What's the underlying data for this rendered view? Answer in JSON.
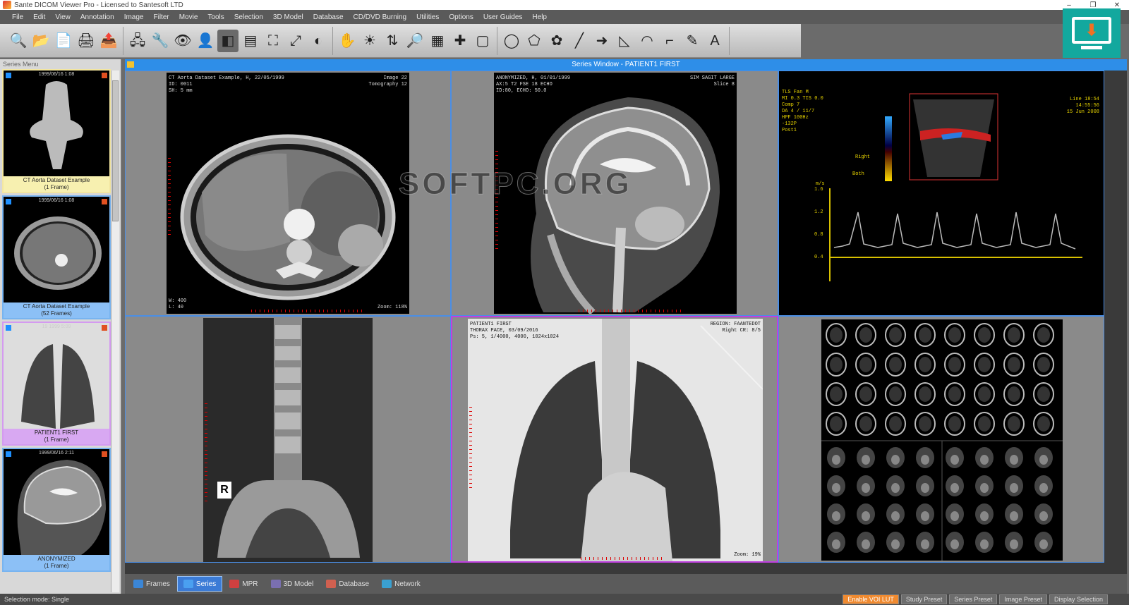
{
  "window": {
    "title": "Sante DICOM Viewer Pro - Licensed to Santesoft LTD",
    "controls": [
      "–",
      "❐",
      "✕"
    ]
  },
  "menu": [
    "File",
    "Edit",
    "View",
    "Annotation",
    "Image",
    "Filter",
    "Movie",
    "Tools",
    "Selection",
    "3D Model",
    "Database",
    "CD/DVD Burning",
    "Utilities",
    "Options",
    "User Guides",
    "Help"
  ],
  "toolbar": {
    "groups": [
      [
        "zoom-icon",
        "open-icon",
        "document-icon",
        "print-icon",
        "export-icon"
      ],
      [
        "network-icon",
        "tools-icon",
        "eye-icon",
        "user-icon",
        "window-level-icon",
        "lut-icon",
        "fit-icon",
        "fullscreen-icon",
        "invert-icon"
      ],
      [
        "hand-icon",
        "brightness-icon",
        "rotate-icon",
        "magnifier-icon",
        "tile-icon",
        "probe-icon",
        "rectangle-icon"
      ],
      [
        "ellipse-roi-icon",
        "polygon-roi-icon",
        "color-icon",
        "line-icon",
        "arrow-icon",
        "angle-icon",
        "cobb-icon",
        "ruler-icon",
        "pencil-icon",
        "text-icon"
      ]
    ],
    "glyphs": [
      "🔍",
      "📂",
      "📄",
      "🖨",
      "📤",
      "🖧",
      "🔧",
      "👁",
      "👤",
      "◧",
      "▤",
      "⛶",
      "⤢",
      "◐",
      "✋",
      "☀",
      "⇅",
      "🔎",
      "▦",
      "✚",
      "▢",
      "◯",
      "⬠",
      "✿",
      "╱",
      "➜",
      "◺",
      "◠",
      "⌐",
      "✎",
      "A"
    ]
  },
  "left_panel": {
    "title": "Series Menu",
    "series": [
      {
        "header": "1999/06/16 1:08",
        "label": "CT Aorta Dataset Example",
        "count": "(1 Frame)",
        "style": "yellow"
      },
      {
        "header": "1999/06/16 1:08",
        "label": "CT Aorta Dataset Example",
        "count": "(52 Frames)",
        "style": "blue"
      },
      {
        "header": "19 1999 5:09",
        "label": "PATIENT1 FIRST",
        "count": "(1 Frame)",
        "style": "purple"
      },
      {
        "header": "1999/06/16 2:11",
        "label": "ANONYMIZED",
        "count": "(1 Frame)",
        "style": "blue"
      }
    ]
  },
  "series_window": {
    "title": "Series Window - PATIENT1 FIRST"
  },
  "viewports": {
    "ct": {
      "tl": "CT Aorta Dataset Example, H, 22/05/1999\nID: 0011\nSH: 5 mm",
      "tr": "Image 22\nTomography 12",
      "bl": "W: 400\nL: 40",
      "br": "Zoom: 118%"
    },
    "mri": {
      "tl": "ANONYMIZED, H, 01/01/1999\nAX:5 T2 FSE 18 ECHO\nID:80, ECHO: 50.0",
      "tr": "SIM SAGIT LARGE\nSlice 8"
    },
    "us": {
      "tl": "TLS Fan M\nMI 0.3 TIS 0.0\nComp 7\nDA 4 / 11/7\nHPF 100Hz\n-132P\nPost1",
      "tr": "Line 18:54\n14:55:56\n15 Jun 2008",
      "label_a": "Right",
      "label_b": "Both",
      "axis_ticks": [
        "1.6",
        "1.2",
        "0.8",
        "0.4"
      ],
      "axis_unit": "m/s"
    },
    "xray": {
      "tl": "PATIENT1 FIRST\nTHORAX PACE, 03/09/2016\nPs: 5, 1/4000, 4000, 1024x1024",
      "tr": "REGION: FAANTEDOT\nRight CR: 8/5",
      "br": "Zoom: 19%"
    },
    "abd": {
      "marker": "R"
    }
  },
  "bottom_tabs": [
    {
      "label": "Frames",
      "icon_color": "#3b86d6",
      "active": false
    },
    {
      "label": "Series",
      "icon_color": "#4aa0f0",
      "active": true
    },
    {
      "label": "MPR",
      "icon_color": "#d04040",
      "active": false
    },
    {
      "label": "3D Model",
      "icon_color": "#7a6fb0",
      "active": false
    },
    {
      "label": "Database",
      "icon_color": "#d06050",
      "active": false
    },
    {
      "label": "Network",
      "icon_color": "#3aa0d0",
      "active": false
    }
  ],
  "status": {
    "left": "Selection mode: Single",
    "items": [
      "Enable VOI LUT",
      "Study Preset",
      "Series Preset",
      "Image Preset",
      "Display Selection"
    ]
  },
  "watermark": "SOFTPC.ORG",
  "colors": {
    "accent": "#2e8ee8",
    "active_border": "#c040e0",
    "download_badge": "#13a89e"
  }
}
